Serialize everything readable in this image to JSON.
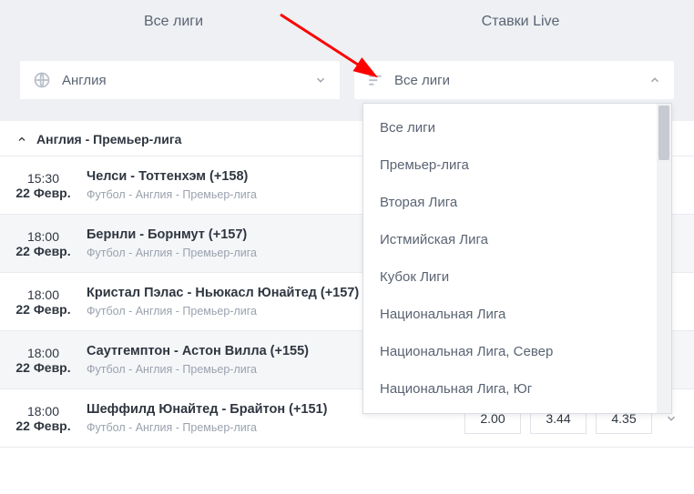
{
  "tabs": {
    "all_leagues": "Все лиги",
    "live": "Ставки Live"
  },
  "filters": {
    "country": {
      "label": "Англия"
    },
    "league": {
      "label": "Все лиги"
    }
  },
  "section_title": "Англия - Премьер-лига",
  "matches": [
    {
      "time": "15:30",
      "date": "22 Февр.",
      "title": "Челси - Тоттенхэм (+158)",
      "sub": "Футбол - Англия - Премьер-лига"
    },
    {
      "time": "18:00",
      "date": "22 Февр.",
      "title": "Бернли - Борнмут (+157)",
      "sub": "Футбол - Англия - Премьер-лига"
    },
    {
      "time": "18:00",
      "date": "22 Февр.",
      "title": "Кристал Пэлас - Ньюкасл Юнайтед (+157)",
      "sub": "Футбол - Англия - Премьер-лига"
    },
    {
      "time": "18:00",
      "date": "22 Февр.",
      "title": "Саутгемптон - Астон Вилла (+155)",
      "sub": "Футбол - Англия - Премьер-лига"
    },
    {
      "time": "18:00",
      "date": "22 Февр.",
      "title": "Шеффилд Юнайтед - Брайтон (+151)",
      "sub": "Футбол - Англия - Премьер-лига",
      "odds": [
        "2.00",
        "3.44",
        "4.35"
      ]
    }
  ],
  "dropdown_items": [
    "Все лиги",
    "Премьер-лига",
    "Вторая Лига",
    "Истмийская Лига",
    "Кубок Лиги",
    "Национальная Лига",
    "Национальная Лига, Север",
    "Национальная Лига, Юг"
  ]
}
